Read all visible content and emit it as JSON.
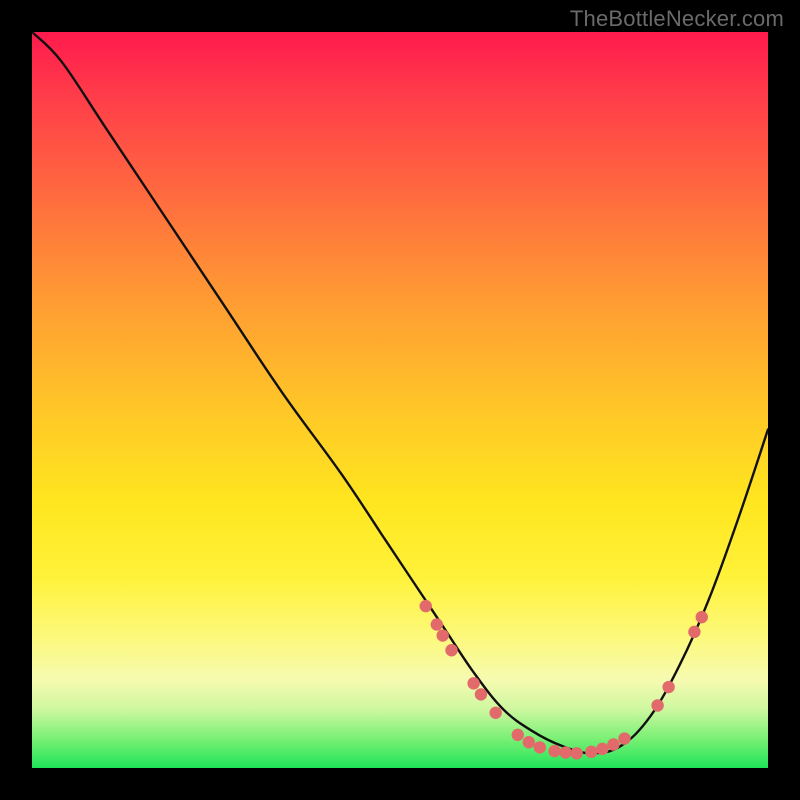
{
  "watermark": {
    "text": "TheBottleNecker.com"
  },
  "colors": {
    "page_bg": "#000000",
    "curve_stroke": "#111111",
    "marker_fill": "#e36a6a",
    "marker_stroke": "#b84d4d"
  },
  "chart_data": {
    "type": "line",
    "title": "",
    "xlabel": "",
    "ylabel": "",
    "xlim": [
      0,
      100
    ],
    "ylim": [
      0,
      100
    ],
    "grid": false,
    "series": [
      {
        "name": "bottleneck-curve",
        "x": [
          0,
          4,
          10,
          18,
          26,
          34,
          42,
          48,
          52,
          56,
          60,
          64,
          68,
          72,
          76,
          80,
          84,
          88,
          92,
          96,
          100
        ],
        "values": [
          100,
          96,
          87,
          75,
          63,
          51,
          40,
          31,
          25,
          19,
          13,
          8,
          5,
          3,
          2,
          3,
          7,
          14,
          23,
          34,
          46
        ]
      }
    ],
    "markers": [
      {
        "x": 53.5,
        "y": 22.0
      },
      {
        "x": 55.0,
        "y": 19.5
      },
      {
        "x": 55.8,
        "y": 18.0
      },
      {
        "x": 57.0,
        "y": 16.0
      },
      {
        "x": 60.0,
        "y": 11.5
      },
      {
        "x": 61.0,
        "y": 10.0
      },
      {
        "x": 63.0,
        "y": 7.5
      },
      {
        "x": 66.0,
        "y": 4.5
      },
      {
        "x": 67.5,
        "y": 3.5
      },
      {
        "x": 69.0,
        "y": 2.8
      },
      {
        "x": 71.0,
        "y": 2.3
      },
      {
        "x": 72.5,
        "y": 2.1
      },
      {
        "x": 74.0,
        "y": 2.0
      },
      {
        "x": 76.0,
        "y": 2.2
      },
      {
        "x": 77.5,
        "y": 2.6
      },
      {
        "x": 79.0,
        "y": 3.2
      },
      {
        "x": 80.5,
        "y": 4.0
      },
      {
        "x": 85.0,
        "y": 8.5
      },
      {
        "x": 86.5,
        "y": 11.0
      },
      {
        "x": 90.0,
        "y": 18.5
      },
      {
        "x": 91.0,
        "y": 20.5
      }
    ]
  }
}
